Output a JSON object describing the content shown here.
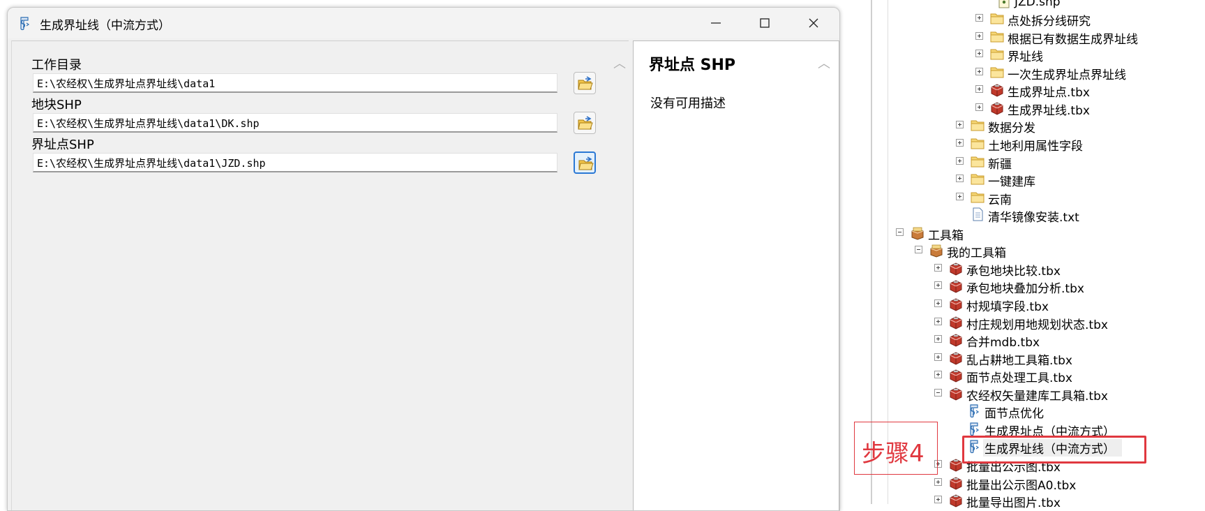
{
  "dialog": {
    "title": "生成界址线（中流方式）",
    "params": [
      {
        "label": "工作目录",
        "value": "E:\\农经权\\生成界址点界址线\\data1"
      },
      {
        "label": "地块SHP",
        "value": "E:\\农经权\\生成界址点界址线\\data1\\DK.shp"
      },
      {
        "label": "界址点SHP",
        "value": "E:\\农经权\\生成界址点界址线\\data1\\JZD.shp"
      }
    ],
    "help": {
      "title": "界址点 SHP",
      "description": "没有可用描述"
    }
  },
  "tree": {
    "items": [
      {
        "label": "JZD.shp"
      },
      {
        "label": "点处拆分线研究"
      },
      {
        "label": "根据已有数据生成界址线"
      },
      {
        "label": "界址线"
      },
      {
        "label": "一次生成界址点界址线"
      },
      {
        "label": "生成界址点.tbx"
      },
      {
        "label": "生成界址线.tbx"
      },
      {
        "label": "数据分发"
      },
      {
        "label": "土地利用属性字段"
      },
      {
        "label": "新疆"
      },
      {
        "label": "一键建库"
      },
      {
        "label": "云南"
      },
      {
        "label": "清华镜像安装.txt"
      },
      {
        "label": "工具箱"
      },
      {
        "label": "我的工具箱"
      },
      {
        "label": "承包地块比较.tbx"
      },
      {
        "label": "承包地块叠加分析.tbx"
      },
      {
        "label": "村规填字段.tbx"
      },
      {
        "label": "村庄规划用地规划状态.tbx"
      },
      {
        "label": "合并mdb.tbx"
      },
      {
        "label": "乱占耕地工具箱.tbx"
      },
      {
        "label": "面节点处理工具.tbx"
      },
      {
        "label": "农经权矢量建库工具箱.tbx"
      },
      {
        "label": "面节点优化"
      },
      {
        "label": "生成界址点（中流方式）"
      },
      {
        "label": "生成界址线（中流方式）"
      },
      {
        "label": "批量出公示图.tbx"
      },
      {
        "label": "批量出公示图A0.tbx"
      },
      {
        "label": "批量导出图片.tbx"
      }
    ]
  },
  "annotation": {
    "step_label": "步骤4",
    "color": "#e0383f"
  },
  "icons": {
    "folder": "folder-icon",
    "toolbox": "toolbox-icon",
    "script": "script-tool-icon",
    "text_file": "text-file-icon",
    "shapefile": "shapefile-icon"
  }
}
